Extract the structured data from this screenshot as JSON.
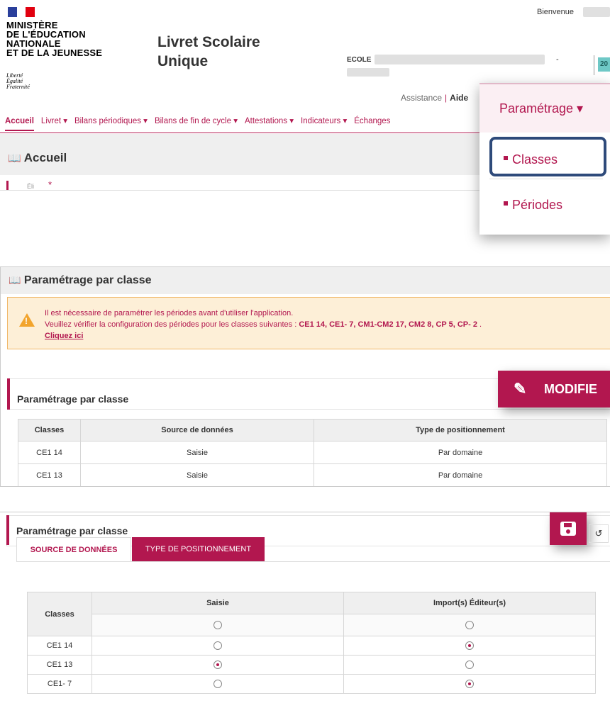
{
  "header": {
    "ministry_lines": [
      "MINISTÈRE",
      "DE L'ÉDUCATION",
      "NATIONALE",
      "ET DE LA JEUNESSE"
    ],
    "motto_lines": [
      "Liberté",
      "Égalité",
      "Fraternité"
    ],
    "app_title_lines": [
      "Livret Scolaire",
      "Unique"
    ],
    "welcome": "Bienvenue",
    "school_label": "ECOLE",
    "school_dash": "-",
    "year_badge": "20",
    "assistance": "Assistance",
    "aide": "Aide"
  },
  "nav": {
    "items": [
      "Accueil",
      "Livret ▾",
      "Bilans périodiques ▾",
      "Bilans de fin de cycle ▾",
      "Attestations ▾",
      "Indicateurs ▾",
      "Échanges"
    ]
  },
  "accueil": {
    "title": "Accueil",
    "field_hint": "Éli",
    "required": "*"
  },
  "dropdown": {
    "header": "Paramétrage ▾",
    "items": [
      "Classes",
      "Périodes"
    ]
  },
  "panel2": {
    "title": "Paramétrage par classe",
    "warning": {
      "line1": "Il est nécessaire de paramétrer les périodes avant d'utiliser l'application.",
      "line2_prefix": "Veuillez vérifier la configuration des périodes pour les classes suivantes : ",
      "line2_classes": "CE1 14, CE1- 7, CM1-CM2 17, CM2 8, CP 5, CP- 2",
      "line2_suffix": " .",
      "link": "Cliquez ici"
    },
    "section_title": "Paramétrage par classe",
    "modify_button": "MODIFIE",
    "table": {
      "headers": [
        "Classes",
        "Source de données",
        "Type de positionnement"
      ],
      "rows": [
        [
          "CE1 14",
          "Saisie",
          "Par domaine"
        ],
        [
          "CE1 13",
          "Saisie",
          "Par domaine"
        ]
      ]
    }
  },
  "panel3": {
    "section_title": "Paramétrage par classe",
    "undo_icon": "↺",
    "tabs": [
      "SOURCE DE DONNÉES",
      "TYPE DE POSITIONNEMENT"
    ],
    "table": {
      "headers": [
        "Classes",
        "Saisie",
        "Import(s) Éditeur(s)"
      ],
      "rows": [
        {
          "classe": "CE1 14",
          "saisie": false,
          "import": true
        },
        {
          "classe": "CE1 13",
          "saisie": true,
          "import": false
        },
        {
          "classe": "CE1- 7",
          "saisie": false,
          "import": true
        }
      ]
    }
  },
  "colors": {
    "accent": "#b2174f",
    "highlight_border": "#2e4a7a",
    "warning_bg": "#fdefd7"
  }
}
